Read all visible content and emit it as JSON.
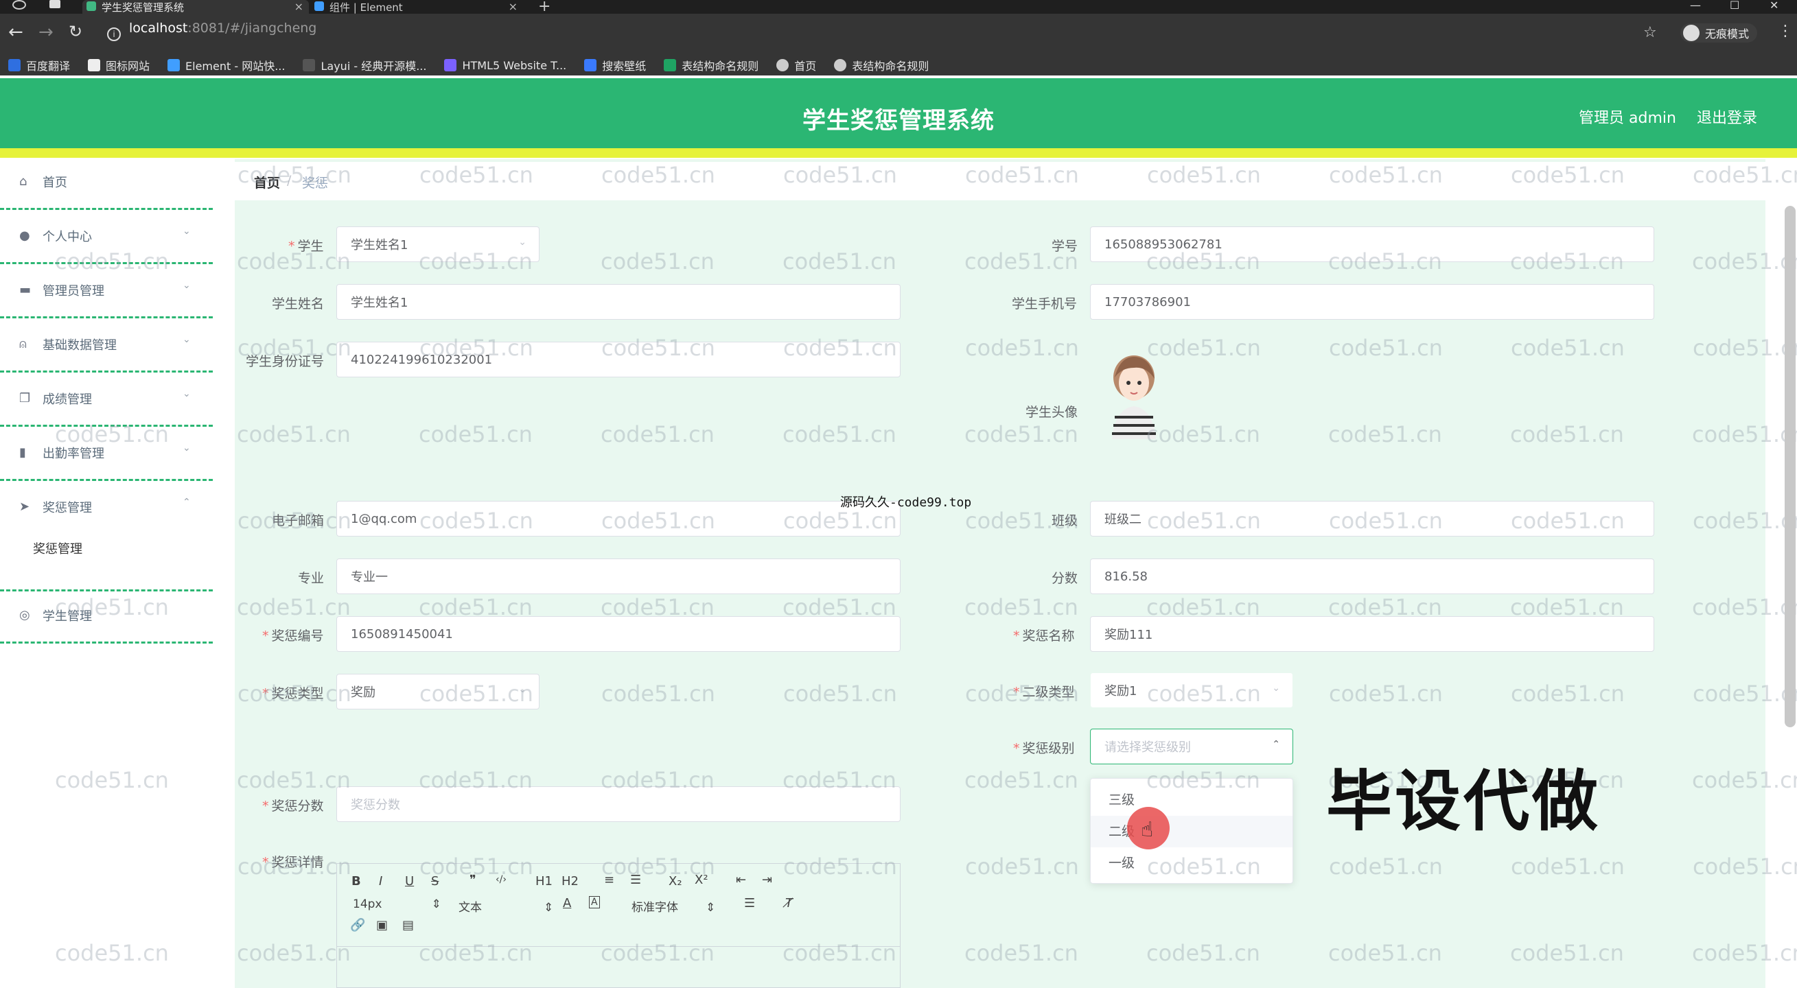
{
  "browser": {
    "tabs": [
      {
        "label": "学生奖惩管理系统",
        "active": true
      },
      {
        "label": "组件 | Element",
        "active": false
      }
    ],
    "url_host": "localhost",
    "url_rest": ":8081/#/jiangcheng",
    "incognito_label": "无痕模式",
    "bookmarks": [
      "百度翻译",
      "图标网站",
      "Element - 网站快...",
      "Layui - 经典开源模...",
      "HTML5 Website T...",
      "搜索壁纸",
      "表结构命名规则",
      "首页",
      "表结构命名规则"
    ]
  },
  "header": {
    "title": "学生奖惩管理系统",
    "admin": "管理员 admin",
    "logout": "退出登录",
    "bg_color": "#2bb673",
    "strip_color": "#e6f23a"
  },
  "sidebar": {
    "items": [
      {
        "label": "首页",
        "icon": "home-icon"
      },
      {
        "label": "个人中心",
        "icon": "user-icon"
      },
      {
        "label": "管理员管理",
        "icon": "chat-icon"
      },
      {
        "label": "基础数据管理",
        "icon": "mic-icon"
      },
      {
        "label": "成绩管理",
        "icon": "copy-icon"
      },
      {
        "label": "出勤率管理",
        "icon": "bar-chart-icon"
      },
      {
        "label": "奖惩管理",
        "icon": "send-icon"
      },
      {
        "label": "学生管理",
        "icon": "globe-icon"
      }
    ],
    "submenu_item": "奖惩管理"
  },
  "breadcrumb": {
    "home": "首页",
    "sep": "/",
    "current": "奖惩"
  },
  "form": {
    "student_label": "学生",
    "student_value": "学生姓名1",
    "student_no_label": "学号",
    "student_no_value": "165088953062781",
    "student_name_label": "学生姓名",
    "student_name_value": "学生姓名1",
    "phone_label": "学生手机号",
    "phone_value": "17703786901",
    "idcard_label": "学生身份证号",
    "idcard_value": "410224199610232001",
    "avatar_label": "学生头像",
    "email_label": "电子邮箱",
    "email_value": "1@qq.com",
    "class_label": "班级",
    "class_value": "班级二",
    "major_label": "专业",
    "major_value": "专业一",
    "score_label": "分数",
    "score_value": "816.58",
    "code_label": "奖惩编号",
    "code_value": "1650891450041",
    "name_label": "奖惩名称",
    "name_value": "奖励111",
    "type_label": "奖惩类型",
    "type_value": "奖励",
    "subtype_label": "二级类型",
    "subtype_value": "奖励1",
    "level_label": "奖惩级别",
    "level_placeholder": "请选择奖惩级别",
    "points_label": "奖惩分数",
    "points_placeholder": "奖惩分数",
    "detail_label": "奖惩详情"
  },
  "dropdown": {
    "options": [
      "三级",
      "二级",
      "一级"
    ],
    "hovered_index": 1
  },
  "editor": {
    "font_size": "14px",
    "format": "文本",
    "font_family": "标准字体",
    "buttons": [
      "B",
      "I",
      "U",
      "S",
      "❞",
      "‹/›",
      "H1",
      "H2",
      "list-ordered-icon",
      "list-bullet-icon",
      "X₂",
      "X²",
      "indent-decrease-icon",
      "indent-increase-icon",
      "A",
      "A",
      "align-icon",
      "clear-format-icon",
      "link-icon",
      "image-icon",
      "video-icon"
    ]
  },
  "overlay": {
    "watermark": "code51.cn",
    "center_text": "源码久久-code99.top",
    "promo": "毕设代做"
  }
}
